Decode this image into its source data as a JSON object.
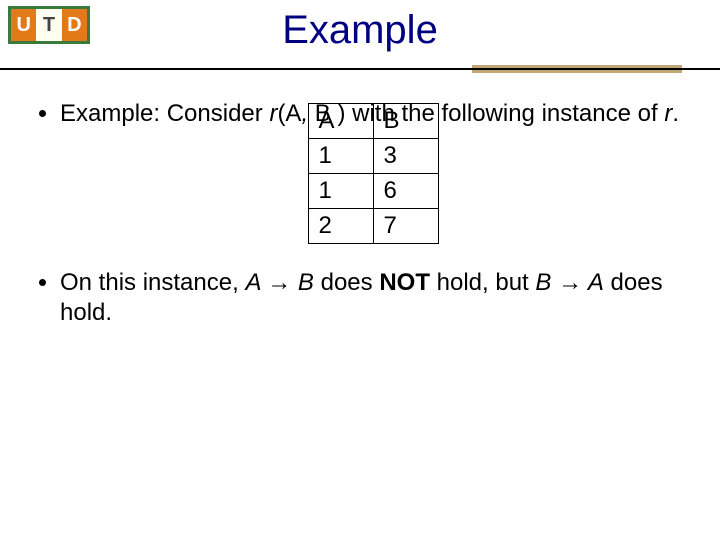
{
  "logo": {
    "u": "U",
    "t": "T",
    "d": "D"
  },
  "title": "Example",
  "bullets": {
    "b1_pre": "Example:  Consider ",
    "b1_r": "r",
    "b1_paren_open": "(A",
    "b1_comma": ", ",
    "b1_B": "B ",
    "b1_paren_close": ") with the following instance of ",
    "b1_r2": "r",
    "b1_period": ".",
    "b2_pre": "On this instance, ",
    "b2_A": "A ",
    "b2_arrow1": "→",
    "b2_B": " B",
    "b2_mid": " does ",
    "b2_not": "NOT",
    "b2_hold": " hold, but  ",
    "b2_B2": "B ",
    "b2_arrow2": "→",
    "b2_A2": " A",
    "b2_tail": " does hold."
  },
  "table": {
    "h1": "A",
    "h2": "B",
    "r1c1": "1",
    "r1c2": "3",
    "r2c1": "1",
    "r2c2": "6",
    "r3c1": "2",
    "r3c2": "7"
  }
}
